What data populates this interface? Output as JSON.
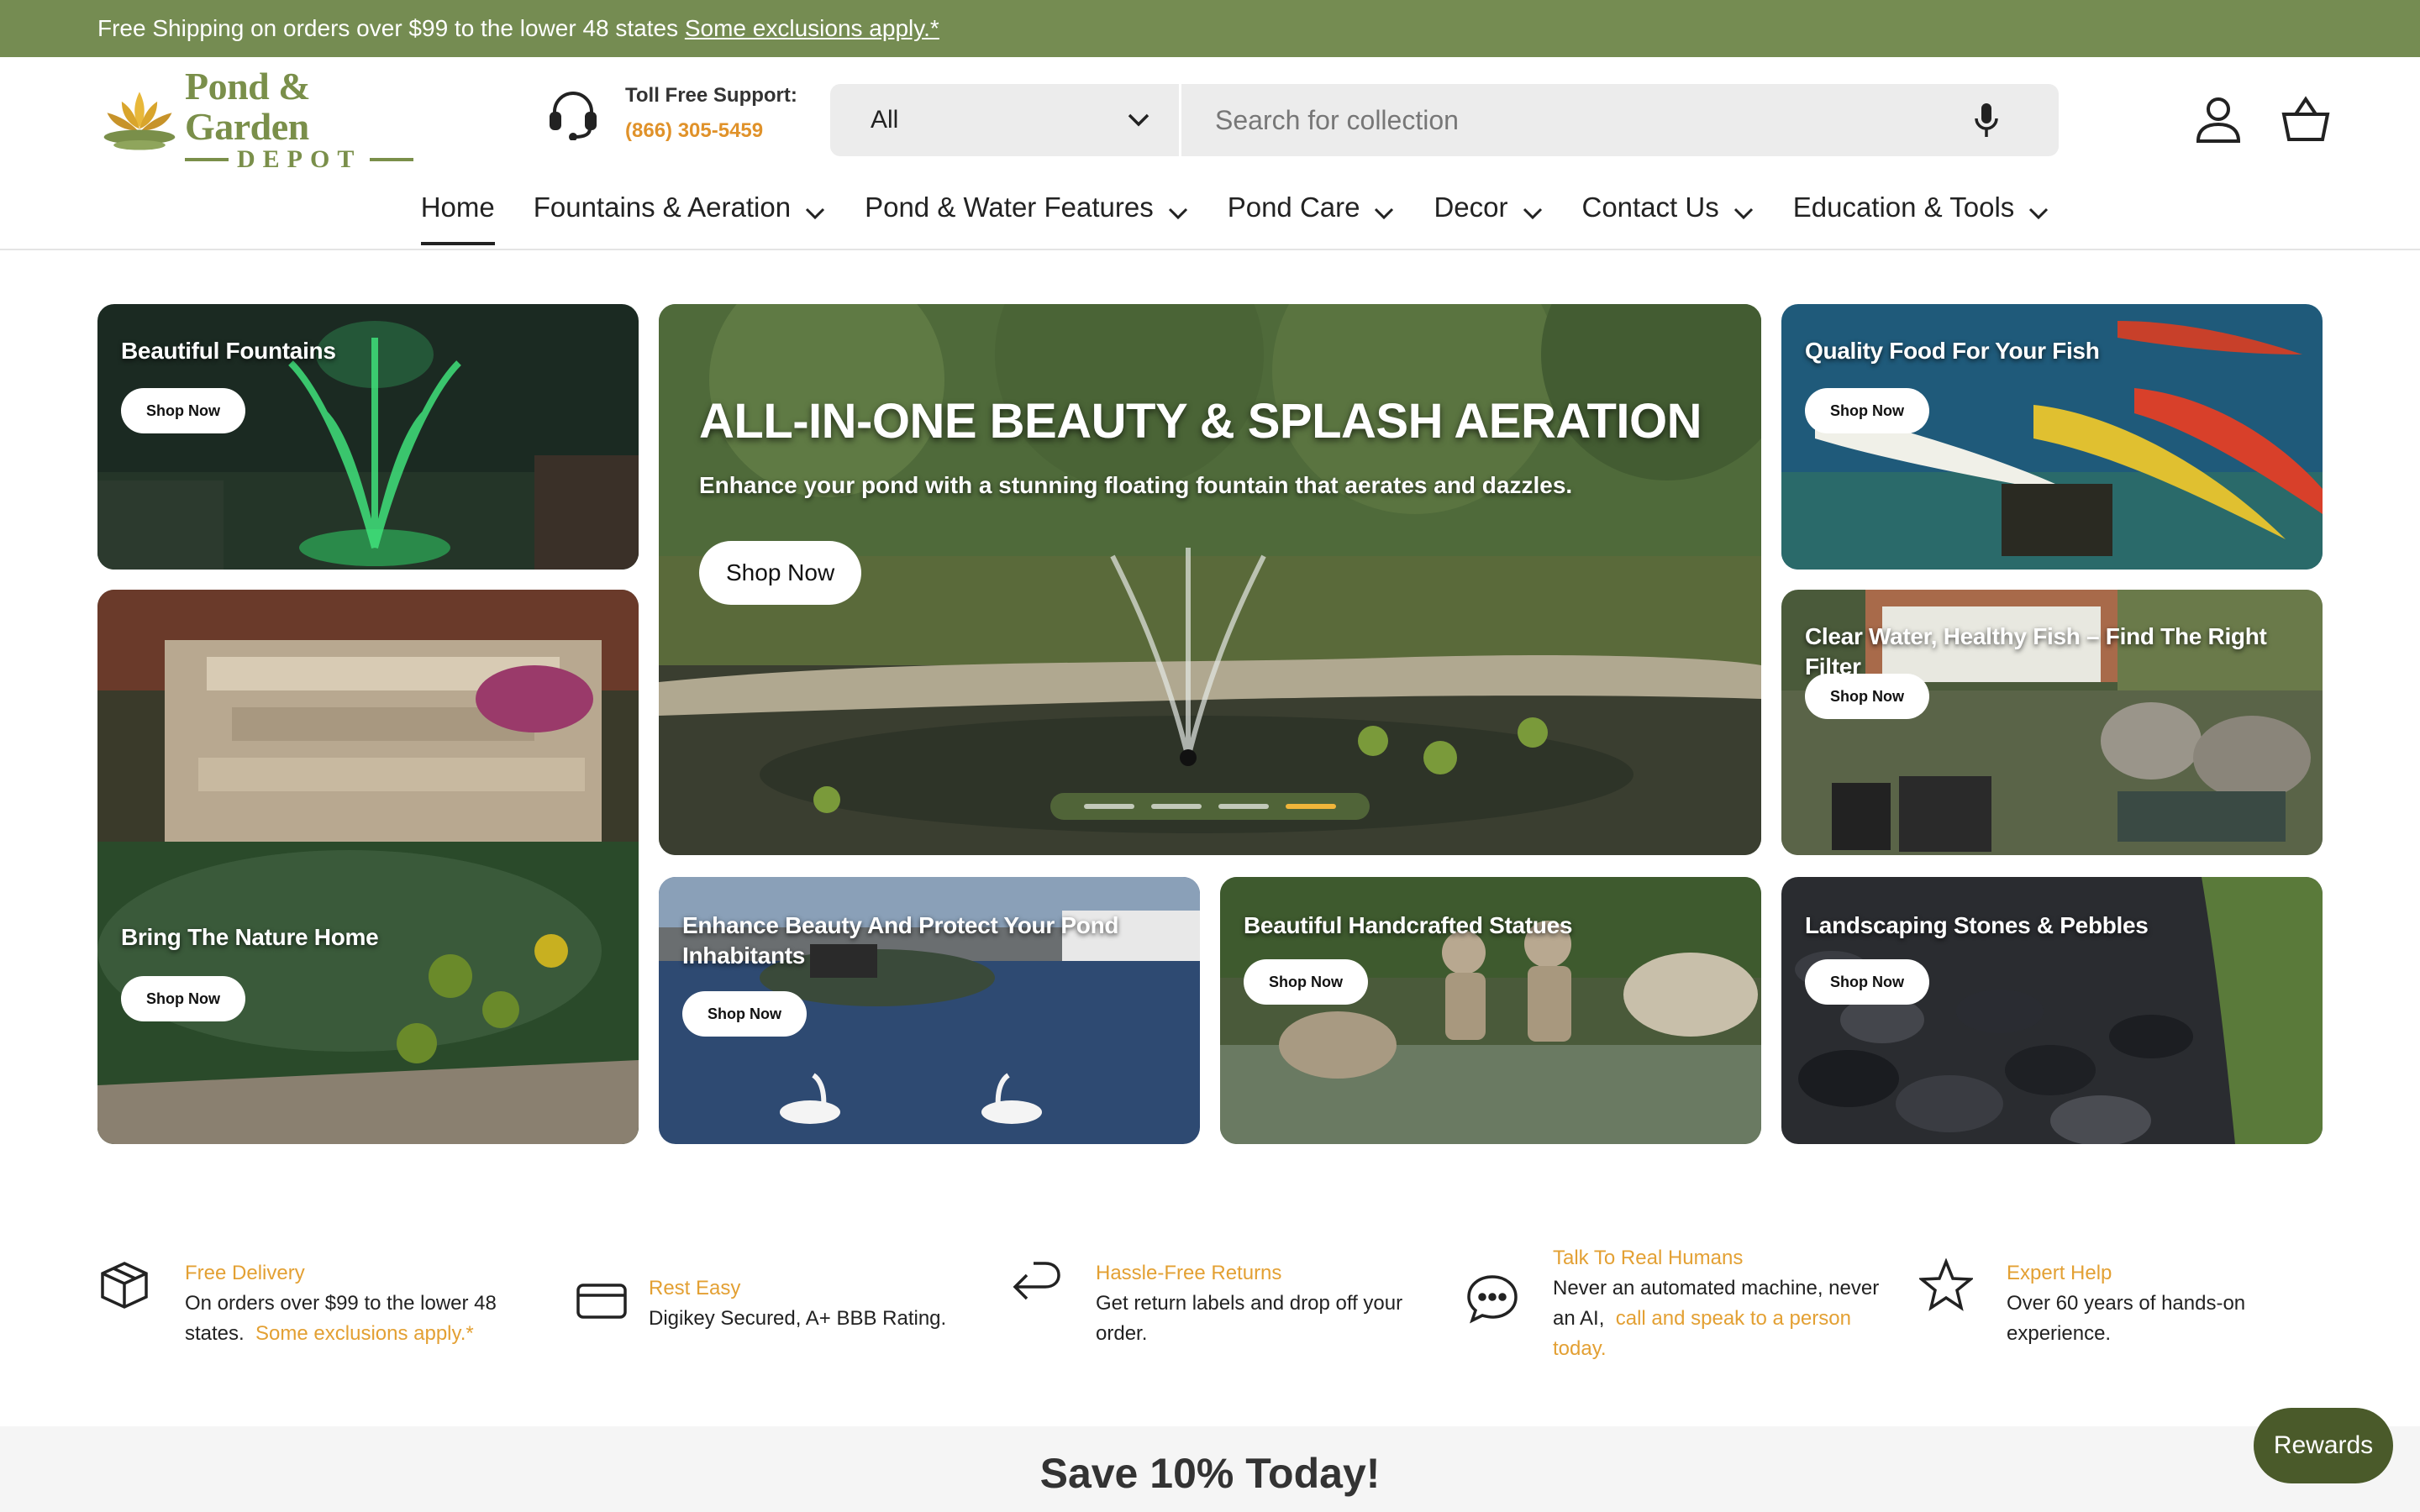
{
  "announcement": {
    "text": "Free Shipping on orders over $99 to the lower 48 states",
    "link": "Some exclusions apply.*"
  },
  "logo": {
    "title": "Pond & Garden",
    "subtitle": "DEPOT"
  },
  "support": {
    "label": "Toll Free Support:",
    "phone": "(866) 305-5459"
  },
  "search": {
    "category": "All",
    "placeholder": "Search for collection"
  },
  "nav": {
    "items": [
      {
        "label": "Home"
      },
      {
        "label": "Fountains & Aeration"
      },
      {
        "label": "Pond & Water Features"
      },
      {
        "label": "Pond Care"
      },
      {
        "label": "Decor"
      },
      {
        "label": "Contact Us"
      },
      {
        "label": "Education & Tools"
      }
    ]
  },
  "tiles": {
    "fountains": {
      "title": "Beautiful Fountains",
      "button": "Shop Now"
    },
    "nature": {
      "title": "Bring The Nature Home",
      "button": "Shop Now"
    },
    "hero": {
      "title": "ALL-IN-ONE BEAUTY & SPLASH AERATION",
      "subtitle": "Enhance your pond with a stunning floating fountain that aerates and dazzles.",
      "button": "Shop Now",
      "slides": 4,
      "active_slide": 4
    },
    "fish_food": {
      "title": "Quality Food For Your Fish",
      "button": "Shop Now"
    },
    "filter": {
      "title": "Clear Water, Healthy Fish – Find The Right Filter",
      "button": "Shop Now"
    },
    "protect": {
      "title_line1": "Enhance Beauty And Protect Your Pond",
      "title_line2": "Inhabitants",
      "button": "Shop Now"
    },
    "statues": {
      "title": "Beautiful Handcrafted Statues",
      "button": "Shop Now"
    },
    "stones": {
      "title": "Landscaping Stones & Pebbles",
      "button": "Shop Now"
    }
  },
  "features": [
    {
      "icon": "box-icon",
      "title": "Free Delivery",
      "line1": "On orders over $99 to the lower 48",
      "line2_prefix": "states.",
      "line2_link": "Some exclusions apply.*"
    },
    {
      "icon": "credit-card-icon",
      "title": "Rest Easy",
      "line1": "Digikey Secured, A+ BBB Rating."
    },
    {
      "icon": "return-arrow-icon",
      "title": "Hassle-Free Returns",
      "line1": "Get return labels and drop off your",
      "line2": "order."
    },
    {
      "icon": "chat-bubble-icon",
      "title": "Talk To Real Humans",
      "line1": "Never an automated machine, never",
      "line2_prefix": "an AI,",
      "line2_link": "call and speak to a person",
      "line3_link": "today."
    },
    {
      "icon": "star-icon",
      "title": "Expert Help",
      "line1": "Over 60 years of hands-on",
      "line2": "experience."
    }
  ],
  "promo": {
    "text": "Save 10% Today!"
  },
  "rewards": {
    "label": "Rewards"
  },
  "colors": {
    "brand_green": "#758c52",
    "accent_orange": "#e3a033",
    "rewards_green": "#4a5a2a",
    "carousel_active": "#f0b53a"
  }
}
